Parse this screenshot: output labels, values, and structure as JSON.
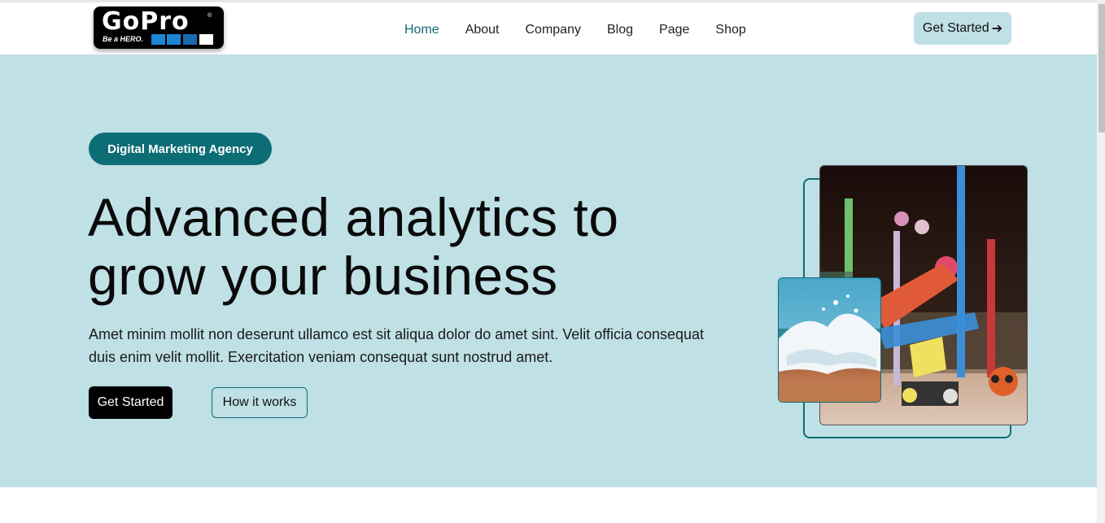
{
  "logo": {
    "word": "GoPro",
    "reg": "®",
    "tagline": "Be a HERO.",
    "colors": [
      "#1d86d3",
      "#1d86d3",
      "#1b6ab0",
      "#ffffff"
    ]
  },
  "nav": {
    "links": [
      "Home",
      "About",
      "Company",
      "Blog",
      "Page",
      "Shop"
    ],
    "active": "Home",
    "cta_label": "Get Started",
    "cta_icon": "arrow-right-icon"
  },
  "hero": {
    "badge": "Digital Marketing Agency",
    "title": "Advanced analytics to grow your business",
    "text": "Amet minim mollit non deserunt ullamco est sit aliqua dolor do amet sint. Velit officia consequat duis enim velit mollit. Exercitation veniam consequat sunt nostrud amet.",
    "primary_label": "Get Started",
    "secondary_label": "How it works"
  },
  "colors": {
    "accent": "#0d6d75",
    "hero_bg": "#bfe0e5",
    "nav_button_bg": "#bfe0e6",
    "active_link": "#0f6a73"
  }
}
